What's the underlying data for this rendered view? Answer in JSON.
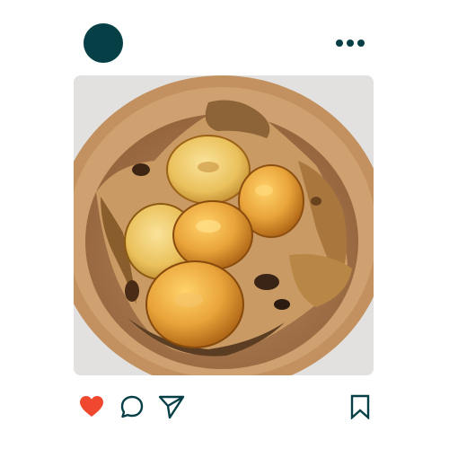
{
  "post": {
    "avatar": {
      "color": "#073f47"
    },
    "more_menu": {
      "icon": "more-horizontal-icon",
      "color": "#073f47"
    },
    "photo": {
      "subject": "bread-pudding-with-caramelized-bananas"
    },
    "actions": {
      "like": {
        "icon": "heart-icon",
        "color": "#f0472f",
        "liked": true
      },
      "comment": {
        "icon": "comment-icon",
        "color": "#073f47"
      },
      "share": {
        "icon": "send-icon",
        "color": "#073f47"
      },
      "save": {
        "icon": "bookmark-icon",
        "color": "#073f47"
      }
    }
  }
}
